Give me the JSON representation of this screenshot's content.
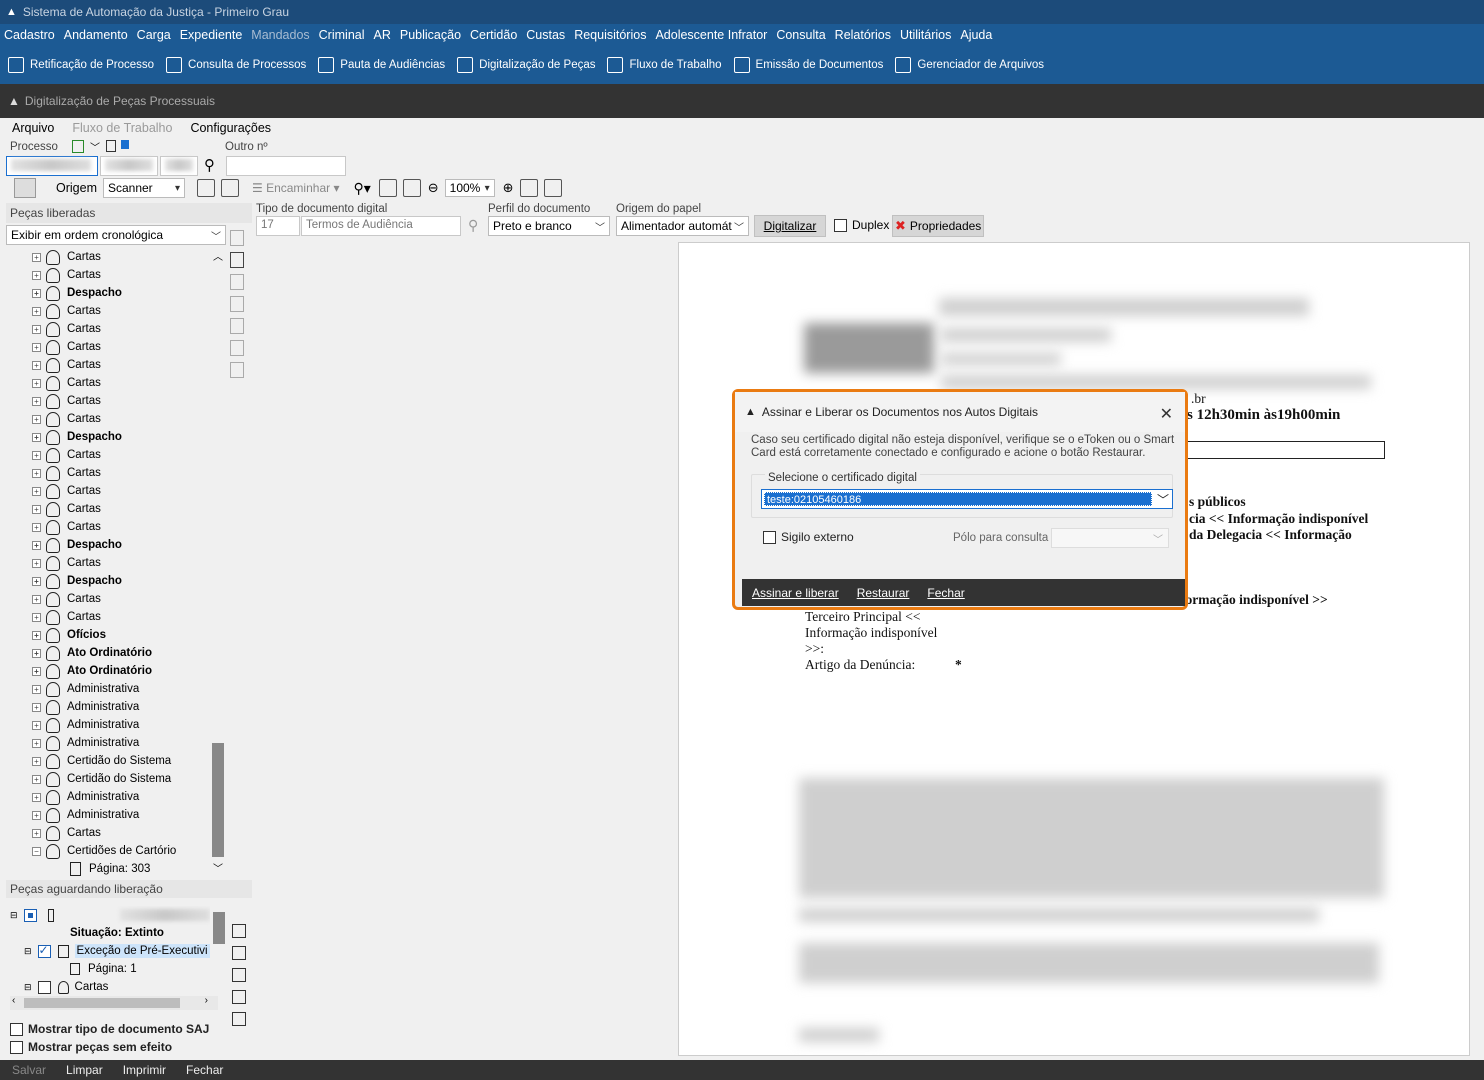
{
  "window_title": "Sistema de Automação da Justiça - Primeiro Grau",
  "menu": [
    "Cadastro",
    "Andamento",
    "Carga",
    "Expediente",
    "Mandados",
    "Criminal",
    "AR",
    "Publicação",
    "Certidão",
    "Custas",
    "Requisitórios",
    "Adolescente Infrator",
    "Consulta",
    "Relatórios",
    "Utilitários",
    "Ajuda"
  ],
  "menu_disabled": "Mandados",
  "toolbar": [
    {
      "label": "Retificação de Processo",
      "icon": "edit-icon"
    },
    {
      "label": "Consulta de Processos",
      "icon": "search-icon"
    },
    {
      "label": "Pauta de Audiências",
      "icon": "calendar-icon"
    },
    {
      "label": "Digitalização de Peças",
      "icon": "scanner-icon"
    },
    {
      "label": "Fluxo de Trabalho",
      "icon": "workflow-icon"
    },
    {
      "label": "Emissão de Documentos",
      "icon": "documents-icon"
    },
    {
      "label": "Gerenciador de Arquivos",
      "icon": "file-manager-icon"
    }
  ],
  "subtitle": "Digitalização de Peças Processuais",
  "app_menu": {
    "arquivo": "Arquivo",
    "fluxo": "Fluxo de Trabalho",
    "config": "Configurações"
  },
  "processo_label": "Processo",
  "outro_label": "Outro nº",
  "origem_label": "Origem",
  "origem_value": "Scanner",
  "encaminhar": "Encaminhar",
  "zoom": "100%",
  "tipo_doc_label": "Tipo de documento digital",
  "tipo_doc_code": "17",
  "tipo_doc_value": "Termos de Audiência",
  "perfil_label": "Perfil do documento",
  "perfil_value": "Preto e branco",
  "origem_papel_label": "Origem do papel",
  "origem_papel_value": "Alimentador automát",
  "digitalizar": "Digitalizar",
  "duplex": "Duplex",
  "propriedades": "Propriedades",
  "pecas_liberadas": "Peças liberadas",
  "ordem": "Exibir em ordem cronológica",
  "tree_items": [
    {
      "label": "Cartas",
      "bold": false
    },
    {
      "label": "Cartas",
      "bold": false
    },
    {
      "label": "Despacho",
      "bold": true
    },
    {
      "label": "Cartas",
      "bold": false
    },
    {
      "label": "Cartas",
      "bold": false
    },
    {
      "label": "Cartas",
      "bold": false
    },
    {
      "label": "Cartas",
      "bold": false
    },
    {
      "label": "Cartas",
      "bold": false
    },
    {
      "label": "Cartas",
      "bold": false
    },
    {
      "label": "Cartas",
      "bold": false
    },
    {
      "label": "Despacho",
      "bold": true
    },
    {
      "label": "Cartas",
      "bold": false
    },
    {
      "label": "Cartas",
      "bold": false
    },
    {
      "label": "Cartas",
      "bold": false
    },
    {
      "label": "Cartas",
      "bold": false
    },
    {
      "label": "Cartas",
      "bold": false
    },
    {
      "label": "Despacho",
      "bold": true
    },
    {
      "label": "Cartas",
      "bold": false
    },
    {
      "label": "Despacho",
      "bold": true
    },
    {
      "label": "Cartas",
      "bold": false
    },
    {
      "label": "Cartas",
      "bold": false
    },
    {
      "label": "Ofícios",
      "bold": true
    },
    {
      "label": "Ato Ordinatório",
      "bold": true
    },
    {
      "label": "Ato Ordinatório",
      "bold": true
    },
    {
      "label": "Administrativa",
      "bold": false
    },
    {
      "label": "Administrativa",
      "bold": false
    },
    {
      "label": "Administrativa",
      "bold": false
    },
    {
      "label": "Administrativa",
      "bold": false
    },
    {
      "label": "Certidão do Sistema",
      "bold": false
    },
    {
      "label": "Certidão do Sistema",
      "bold": false
    },
    {
      "label": "Administrativa",
      "bold": false
    },
    {
      "label": "Administrativa",
      "bold": false
    },
    {
      "label": "Cartas",
      "bold": false
    },
    {
      "label": "Certidões de Cartório",
      "bold": false
    }
  ],
  "tree_page": "Página: 303",
  "aguardando": "Peças aguardando liberação",
  "situacao": "Situação: Extinto",
  "excecao": "Exceção de Pré-Executivi",
  "pagina1": "Página: 1",
  "cartas": "Cartas",
  "mostrar_tipo": "Mostrar tipo de documento SAJ",
  "mostrar_pecas": "Mostrar peças sem efeito",
  "bottom": {
    "salvar": "Salvar",
    "limpar": "Limpar",
    "imprimir": "Imprimir",
    "fechar": "Fechar"
  },
  "doc_lines": [
    ".br",
    "s 12h30min às19h00min",
    "s públicos",
    "cia << Informação indisponível",
    "da Delegacia << Informação",
    "formação indisponível >>",
    "Terceiro Principal <<",
    "Informação indisponível",
    ">>:",
    "Artigo da Denúncia:",
    "*"
  ],
  "dialog": {
    "title": "Assinar e Liberar os Documentos nos Autos Digitais",
    "message": "Caso seu certificado digital não esteja disponível, verifique se o eToken ou o Smart Card está corretamente conectado e configurado e acione o botão Restaurar.",
    "select_label": "Selecione o certificado digital",
    "cert_value": "teste:02105460186",
    "sigilo": "Sigilo externo",
    "polo": "Pólo para consulta",
    "assinar": "Assinar e liberar",
    "restaurar": "Restaurar",
    "fechar": "Fechar"
  },
  "colors": {
    "accent": "#1c5a94",
    "dialog_border": "#ea7b12",
    "selection": "#1a6fd0"
  }
}
